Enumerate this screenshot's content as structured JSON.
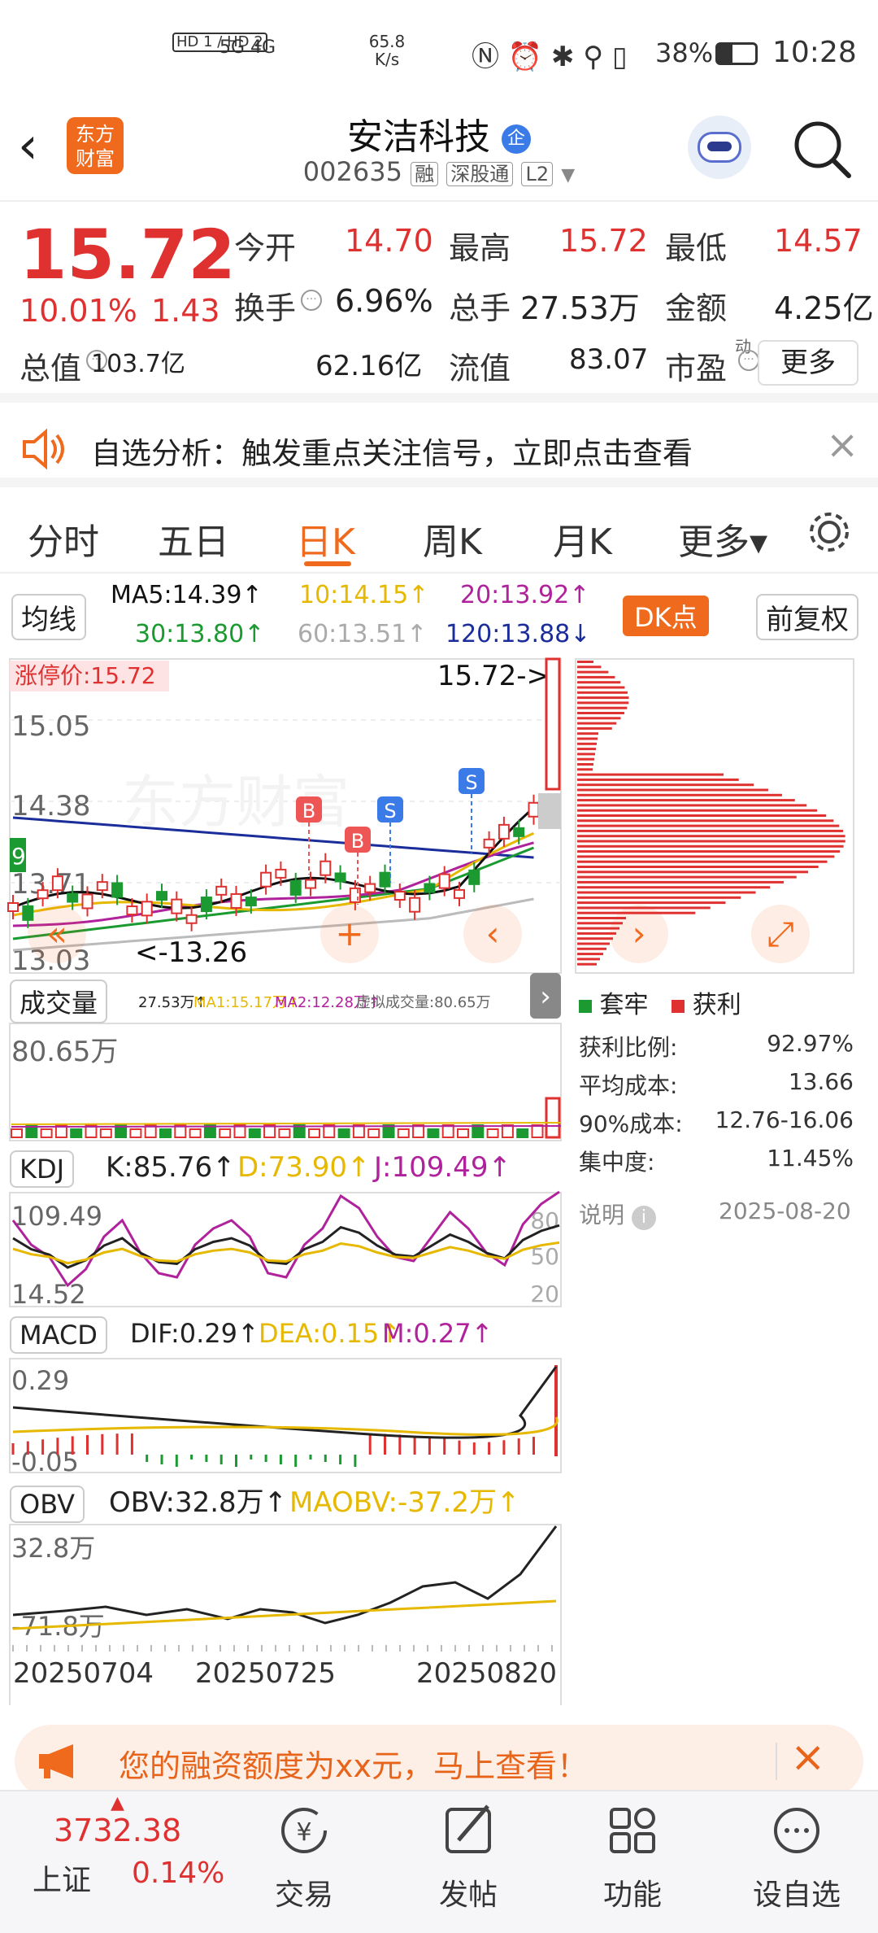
{
  "status_bar": {
    "sim": "HD 1 / HD 2",
    "net": "5G 4G",
    "speed": "65.8",
    "speed_unit": "K/s",
    "battery": "38%",
    "time": "10:28"
  },
  "header": {
    "brand_line1": "东方",
    "brand_line2": "财富",
    "stock_name": "安洁科技",
    "badge": "企",
    "code": "002635",
    "tag1": "融",
    "tag2": "深股通",
    "tag3": "L2"
  },
  "quote": {
    "price": "15.72",
    "change_pct": "10.01%",
    "change": "1.43",
    "fields": [
      {
        "label": "今开",
        "value": "14.70"
      },
      {
        "label": "最高",
        "value": "15.72"
      },
      {
        "label": "最低",
        "value": "14.57"
      },
      {
        "label": "换手",
        "value": "6.96%"
      },
      {
        "label": "总手",
        "value": "27.53万"
      },
      {
        "label": "金额",
        "value": "4.25亿"
      },
      {
        "label": "总值",
        "value": "103.7亿"
      },
      {
        "label": "流值",
        "value": "62.16亿"
      },
      {
        "label": "市盈",
        "sup": "动",
        "value": "83.07"
      }
    ],
    "more": "更多"
  },
  "alert": {
    "text": "自选分析：触发重点关注信号，立即点击查看"
  },
  "tabs": [
    "分时",
    "五日",
    "日K",
    "周K",
    "月K",
    "更多▾"
  ],
  "active_tab": "日K",
  "ma": {
    "btn": "均线",
    "ma5": "MA5:14.39↑",
    "ma10": "10:14.15↑",
    "ma20": "20:13.92↑",
    "ma30": "30:13.80↑",
    "ma60": "60:13.51↑",
    "ma120": "120:13.88↓",
    "dk": "DK点",
    "fq": "前复权"
  },
  "kline": {
    "limit_label": "涨停价:15.72",
    "y_top": "15.72",
    "y1": "15.05",
    "y2": "14.38",
    "y3": "13.71",
    "y4": "13.03",
    "left_tag": "9",
    "high_arrow": "15.72->",
    "low_arrow": "<-13.26",
    "watermark": "东方财富",
    "b_marks": [
      "B",
      "B"
    ],
    "s_marks": [
      "S",
      "S"
    ]
  },
  "chip": {
    "legend_trap": "套牢",
    "legend_profit": "获利",
    "rows": [
      {
        "k": "获利比例:",
        "v": "92.97%"
      },
      {
        "k": "平均成本:",
        "v": "13.66"
      },
      {
        "k": "90%成本:",
        "v": "12.76-16.06"
      },
      {
        "k": "集中度:",
        "v": "11.45%"
      }
    ],
    "note": "说明",
    "date": "2025-08-20"
  },
  "volume": {
    "btn": "成交量",
    "line": "27.53万↑",
    "ma1": "MA1:15.17万↑",
    "ma2": "MA2:12.28万↑",
    "virtual": "虚拟成交量:80.65万",
    "top": "80.65万"
  },
  "kdj": {
    "btn": "KDJ",
    "k": "K:85.76↑",
    "d": "D:73.90↑",
    "j": "J:109.49↑",
    "top": "109.49",
    "bottom": "14.52",
    "l80": "80",
    "l50": "50",
    "l20": "20"
  },
  "macd": {
    "btn": "MACD",
    "dif": "DIF:0.29↑",
    "dea": "DEA:0.15↑",
    "m": "M:0.27↑",
    "top": "0.29",
    "bottom": "-0.05"
  },
  "obv": {
    "btn": "OBV",
    "obv": "OBV:32.8万↑",
    "maobv": "MAOBV:-37.2万↑",
    "top": "32.8万",
    "bottom": "-71.8万"
  },
  "dates": [
    "20250704",
    "20250725",
    "20250820"
  ],
  "banner": {
    "text": "您的融资额度为xx元，马上查看！"
  },
  "nav": {
    "index_value": "3732.38",
    "index_name": "上证",
    "index_change": "0.14%",
    "items": [
      {
        "label": "交易",
        "icon": "trade-icon"
      },
      {
        "label": "发帖",
        "icon": "post-icon"
      },
      {
        "label": "功能",
        "icon": "function-icon"
      },
      {
        "label": "设自选",
        "icon": "add-watchlist-icon"
      }
    ]
  },
  "colors": {
    "up": "#e03131",
    "down": "#1a9a30",
    "accent": "#f06a1d",
    "ma5": "#111",
    "ma10": "#e6b800",
    "ma20": "#b0229c",
    "ma30": "#1a9a30",
    "ma60": "#aaa",
    "ma120": "#1b2d9a"
  }
}
